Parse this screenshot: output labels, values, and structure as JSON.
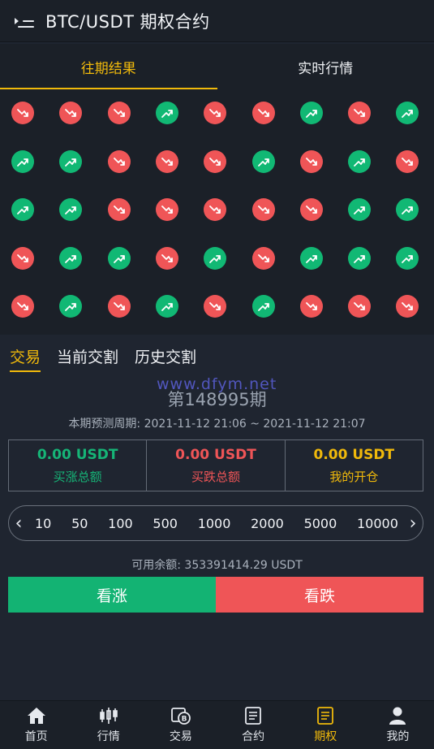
{
  "header": {
    "title": "BTC/USDT 期权合约",
    "menu_icon": "menu-indent-icon"
  },
  "tabs": [
    {
      "label": "往期结果",
      "active": true
    },
    {
      "label": "实时行情",
      "active": false
    }
  ],
  "results": [
    [
      "down",
      "down",
      "down",
      "up",
      "down",
      "down",
      "up",
      "down",
      "up"
    ],
    [
      "up",
      "up",
      "down",
      "down",
      "down",
      "up",
      "down",
      "up",
      "down"
    ],
    [
      "up",
      "up",
      "down",
      "down",
      "down",
      "down",
      "down",
      "up",
      "up"
    ],
    [
      "down",
      "up",
      "up",
      "down",
      "up",
      "down",
      "up",
      "up",
      "up"
    ],
    [
      "down",
      "up",
      "down",
      "up",
      "down",
      "up",
      "down",
      "down",
      "down"
    ]
  ],
  "result_colors": {
    "up": "#11b874",
    "down": "#ef5557"
  },
  "trade_tabs": [
    {
      "label": "交易",
      "active": true
    },
    {
      "label": "当前交割",
      "active": false
    },
    {
      "label": "历史交割",
      "active": false
    }
  ],
  "watermark": "www.dfym.net",
  "period": {
    "label": "第148995期"
  },
  "cycle": {
    "label": "本期预测周期:",
    "range": "2021-11-12 21:06 ~ 2021-11-12 21:07"
  },
  "stats": {
    "up_total": {
      "value": "0.00 USDT",
      "label": "买涨总额"
    },
    "down_total": {
      "value": "0.00 USDT",
      "label": "买跌总额"
    },
    "my_open": {
      "value": "0.00 USDT",
      "label": "我的开仓"
    }
  },
  "amount_options": [
    "10",
    "50",
    "100",
    "500",
    "1000",
    "2000",
    "5000",
    "10000"
  ],
  "balance": {
    "label": "可用余额:",
    "value": "353391414.29 USDT"
  },
  "actions": {
    "up_label": "看涨",
    "down_label": "看跌"
  },
  "nav": [
    {
      "label": "首页",
      "icon": "home-icon",
      "active": false
    },
    {
      "label": "行情",
      "icon": "candlestick-icon",
      "active": false
    },
    {
      "label": "交易",
      "icon": "exchange-icon",
      "active": false
    },
    {
      "label": "合约",
      "icon": "contract-icon",
      "active": false
    },
    {
      "label": "期权",
      "icon": "options-icon",
      "active": true
    },
    {
      "label": "我的",
      "icon": "user-icon",
      "active": false
    }
  ],
  "colors": {
    "accent": "#f0b90b",
    "up": "#13b373",
    "down": "#ef5557",
    "background": "#1f2530"
  }
}
